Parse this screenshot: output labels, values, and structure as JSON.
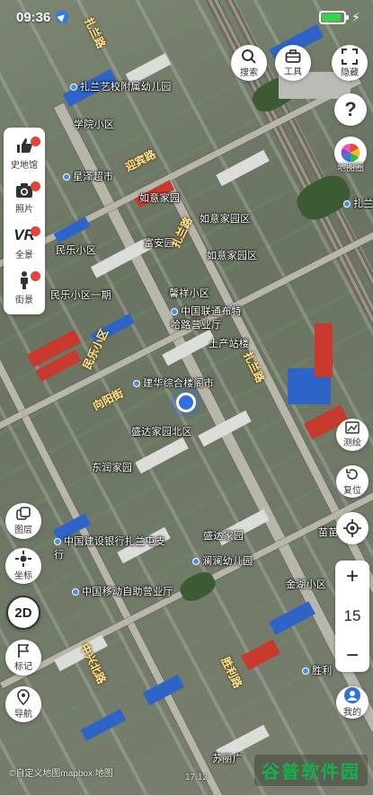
{
  "status_bar": {
    "time": "09:36",
    "battery_level": 0.85
  },
  "top_right": {
    "search_label": "搜索",
    "tools_label": "工具",
    "hide_label": "隐藏",
    "help_glyph": "?",
    "map_style_label": "地图圈"
  },
  "left_panel": [
    {
      "label": "史地馆",
      "icon": "thumbs-up-icon",
      "badge": true
    },
    {
      "label": "照片",
      "icon": "camera-icon",
      "badge": true
    },
    {
      "label": "全景",
      "icon": "vr-icon",
      "icon_text": "VR",
      "badge": true
    },
    {
      "label": "街景",
      "icon": "person-icon",
      "badge": true
    }
  ],
  "left_buttons": {
    "layers_label": "图层",
    "coords_label": "坐标",
    "mode_label": "2D",
    "mark_label": "标记",
    "nav_label": "导航"
  },
  "right_buttons": {
    "measure_label": "测绘",
    "reset_label": "复位",
    "zoom_in": "+",
    "zoom_level": "15",
    "zoom_out": "−",
    "mine_label": "我的"
  },
  "map_labels": {
    "school": "扎兰艺校附属幼儿园",
    "district_xueyuan": "学院小区",
    "supermarket": "星泽超市",
    "yingbin": "迎宾路",
    "xinyi": "如意家园",
    "jiyi": "如意家园区",
    "fuan": "富安园",
    "minle": "民乐小区",
    "minle_yiqi": "民乐小区一期",
    "xiangyu": "馨祥小区",
    "unicom": "中国联通布特哈路营业厅",
    "tushan": "土产站楼",
    "jianhua": "建华综合楼阁市",
    "xiangyang": "向阳街",
    "shengshi": "盛达家园北区",
    "dongrun": "东润家园",
    "ccb": "中国建设银行扎兰屯支行",
    "tiezhong": "盛达家园",
    "kindergarten": "澜澜幼儿园",
    "cmcc": "中国移动自助营业厅",
    "zhongxing": "中兴北路",
    "shenglihu": "胜利路",
    "jinyu": "金湖小区",
    "shengli": "胜利",
    "zhala_road": "扎兰路",
    "zhala_tun": "扎兰屯",
    "miaomiao": "苗苗",
    "nanfang": "苏丽广"
  },
  "footer": {
    "attribution": "©自定义地图mapbox 地图",
    "coordinates": "17.12",
    "brand": "谷普软件园"
  }
}
